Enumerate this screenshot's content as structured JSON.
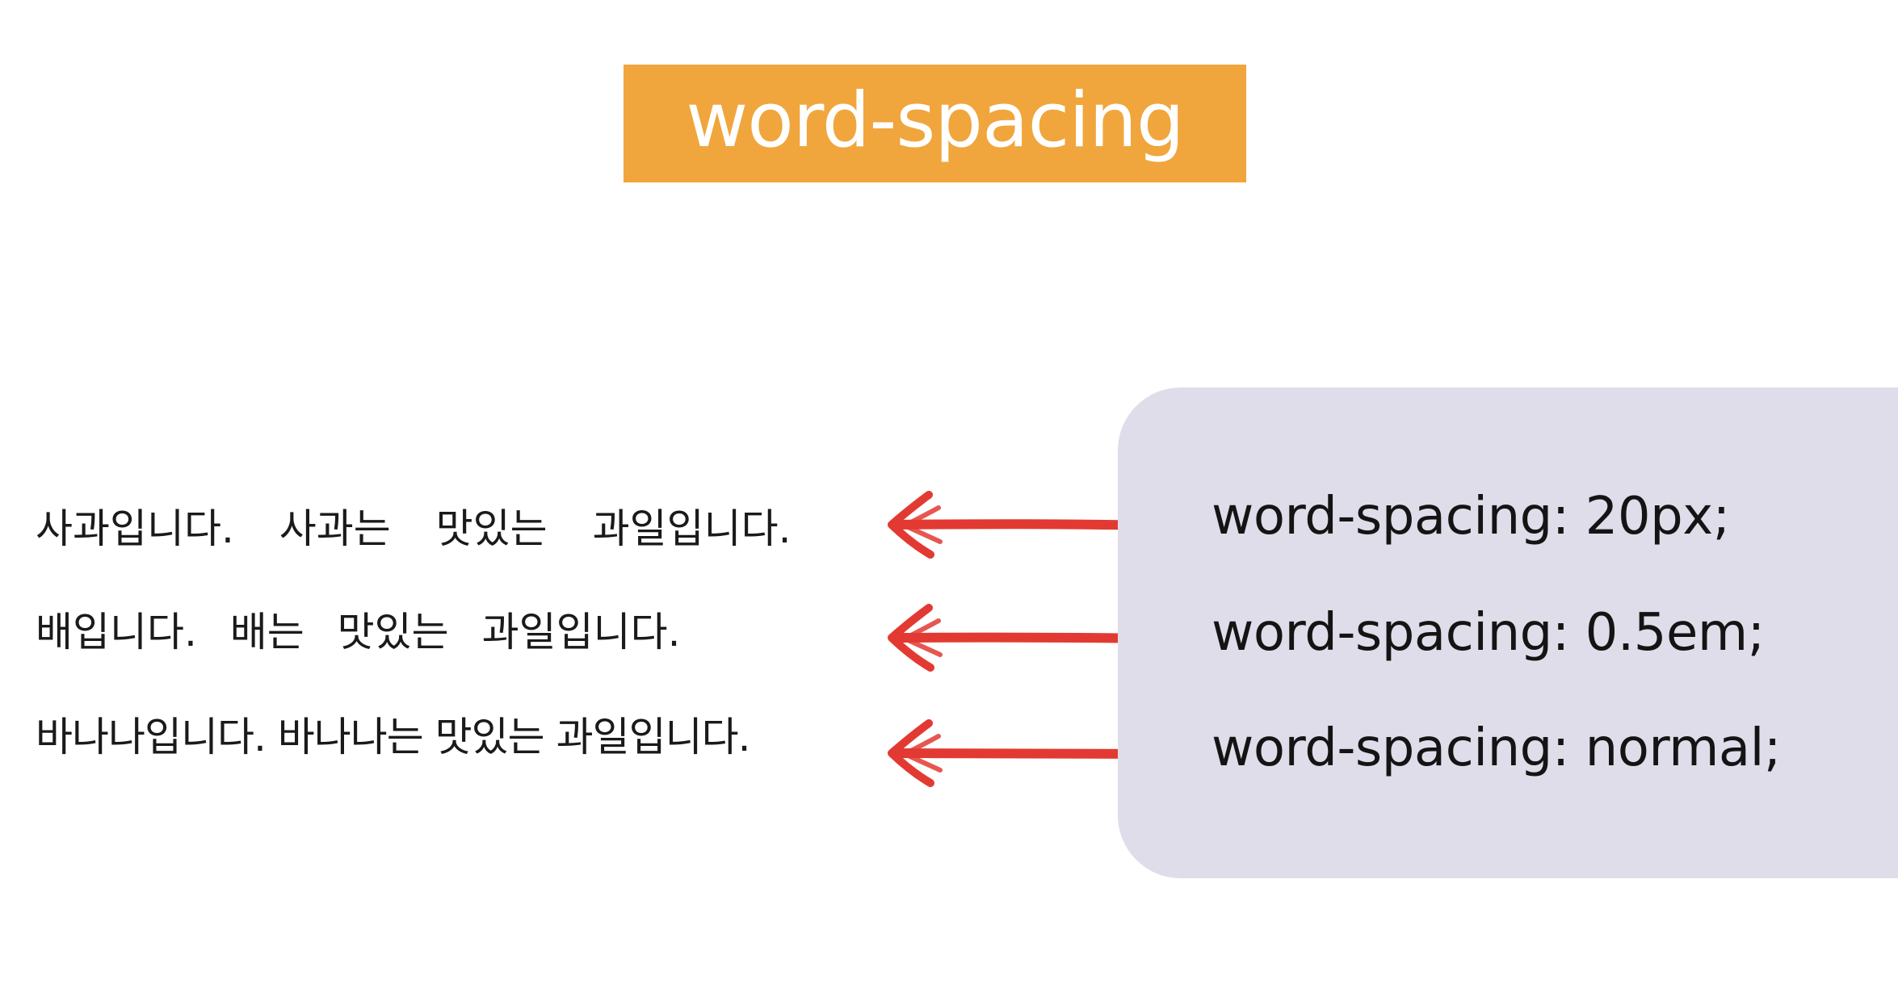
{
  "title": {
    "text": "word-spacing",
    "background_color": "#f0a63c"
  },
  "examples": [
    {
      "text": "사과입니다. 사과는 맛있는 과일입니다.",
      "css": "word-spacing: 20px;"
    },
    {
      "text": "배입니다. 배는 맛있는 과일입니다.",
      "css": "word-spacing: 0.5em;"
    },
    {
      "text": "바나나입니다. 바나나는 맛있는 과일입니다.",
      "css": "word-spacing: normal;"
    }
  ],
  "colors": {
    "arrow": "#e23a32",
    "code_panel": "#dedde9",
    "text": "#1a1a1a"
  },
  "icons": {
    "arrow": "left-arrow-icon"
  }
}
